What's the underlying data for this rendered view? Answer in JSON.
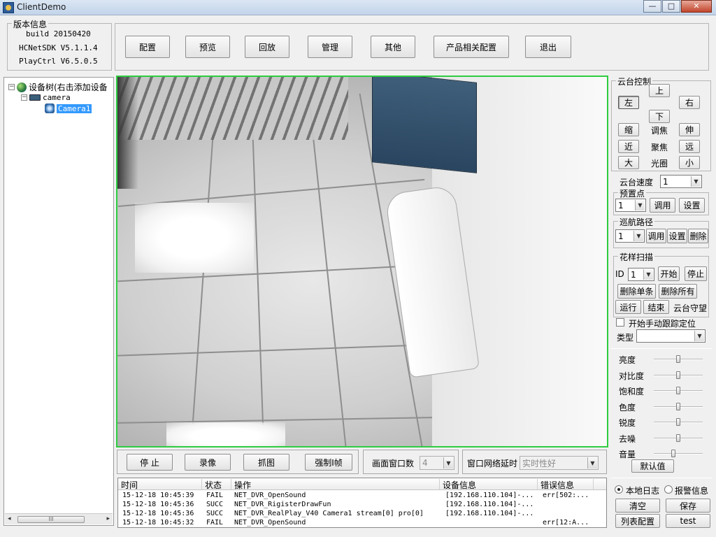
{
  "window": {
    "title": "ClientDemo",
    "minimize": "—",
    "maximize": "□",
    "close": "✕"
  },
  "version": {
    "group_title": "版本信息",
    "build": "build 20150420",
    "sdk": "HCNetSDK V5.1.1.4",
    "playctrl": "PlayCtrl V6.5.0.5"
  },
  "toolbar": {
    "config": "配置",
    "preview": "预览",
    "playback": "回放",
    "manage": "管理",
    "other": "其他",
    "product_config": "产品相关配置",
    "exit": "退出"
  },
  "tree": {
    "root": "设备树(右击添加设备",
    "device": "camera",
    "channel": "Camera1",
    "toggle_open": "−",
    "scroll_left": "◂",
    "scroll_right": "▸",
    "scroll_grip": "III"
  },
  "preview_bar": {
    "stop": "停 止",
    "record": "录像",
    "capture": "抓图",
    "force_iframe": "强制I帧",
    "window_count_label": "画面窗口数",
    "window_count_value": "4",
    "net_delay_label": "窗口网络延时",
    "net_delay_value": "实时性好"
  },
  "log": {
    "columns": [
      "时间",
      "状态",
      "操作",
      "设备信息",
      "错误信息"
    ],
    "rows": [
      {
        "time": "15-12-18 10:45:39",
        "status": "FAIL",
        "op": "NET_DVR_OpenSound",
        "device": "[192.168.110.104]-...",
        "error": "err[502:..."
      },
      {
        "time": "15-12-18 10:45:36",
        "status": "SUCC",
        "op": "NET_DVR_RigisterDrawFun",
        "device": "[192.168.110.104]-...",
        "error": ""
      },
      {
        "time": "15-12-18 10:45:36",
        "status": "SUCC",
        "op": "NET_DVR_RealPlay_V40 Camera1 stream[0] pro[0]",
        "device": "[192.168.110.104]-...",
        "error": ""
      },
      {
        "time": "15-12-18 10:45:32",
        "status": "FAIL",
        "op": "NET_DVR_OpenSound",
        "device": "",
        "error": "err[12:A..."
      }
    ]
  },
  "ptz": {
    "group_title": "云台控制",
    "up": "上",
    "left": "左",
    "right": "右",
    "down": "下",
    "zoom_in": "缩",
    "zoom_label": "调焦",
    "zoom_out": "伸",
    "focus_near": "近",
    "focus_label": "聚焦",
    "focus_far": "远",
    "iris_open": "大",
    "iris_label": "光圈",
    "iris_close": "小",
    "speed_label": "云台速度",
    "speed_value": "1",
    "preset_title": "预置点",
    "preset_value": "1",
    "preset_call": "调用",
    "preset_set": "设置",
    "cruise_title": "巡航路径",
    "cruise_value": "1",
    "cruise_call": "调用",
    "cruise_set": "设置",
    "cruise_delete": "删除",
    "pattern_title": "花样扫描",
    "pattern_id_label": "ID",
    "pattern_id_value": "1",
    "pattern_start": "开始",
    "pattern_stop": "停止",
    "pattern_delete_one": "删除单条",
    "pattern_delete_all": "删除所有",
    "run": "运行",
    "end": "结束",
    "guard": "云台守望",
    "manual_track": "开始手动跟踪定位",
    "type_label": "类型",
    "type_value": ""
  },
  "image": {
    "brightness": "亮度",
    "contrast": "对比度",
    "saturation": "饱和度",
    "hue": "色度",
    "sharpness": "锐度",
    "denoise": "去噪",
    "volume": "音量",
    "default": "默认值",
    "levels": {
      "brightness": 0.5,
      "contrast": 0.5,
      "saturation": 0.5,
      "hue": 0.5,
      "sharpness": 0.5,
      "denoise": 0.5,
      "volume": 0.4
    }
  },
  "log_options": {
    "local_log": "本地日志",
    "alarm_info": "报警信息",
    "clear": "清空",
    "save": "保存",
    "list_config": "列表配置",
    "test": "test"
  },
  "colors": {
    "video_border": "#2ecc40",
    "tree_selected": "#3399ff"
  }
}
